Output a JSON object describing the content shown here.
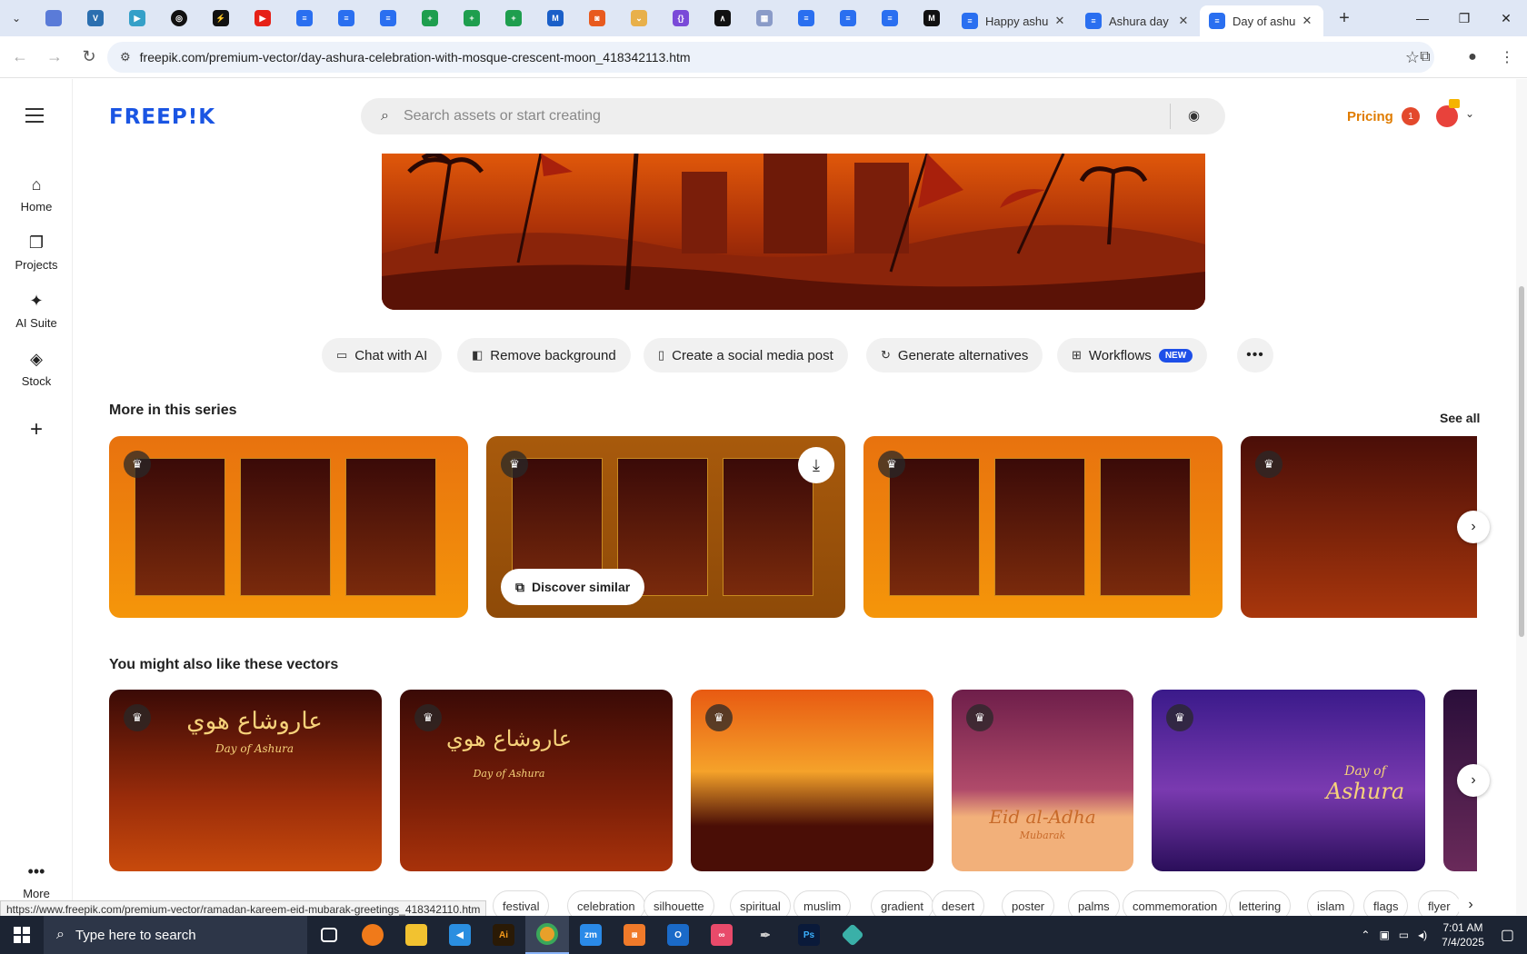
{
  "browser": {
    "tabs": [
      {
        "label": "Happy ashu",
        "icon": "docs-icon"
      },
      {
        "label": "Ashura day",
        "icon": "docs-icon"
      },
      {
        "label": "Day of ashu",
        "icon": "docs-icon",
        "active": true
      }
    ],
    "url": "freepik.com/premium-vector/day-ashura-celebration-with-mosque-crescent-moon_418342113.htm",
    "status_url": "https://www.freepik.com/premium-vector/ramadan-kareem-eid-mubarak-greetings_418342110.htm"
  },
  "sidebar": {
    "items": [
      {
        "label": "Home",
        "icon": "home-icon"
      },
      {
        "label": "Projects",
        "icon": "projects-icon"
      },
      {
        "label": "AI Suite",
        "icon": "sparkle-icon"
      },
      {
        "label": "Stock",
        "icon": "stock-icon"
      }
    ],
    "more_label": "More"
  },
  "header": {
    "logo": "FREEP!K",
    "search_placeholder": "Search assets or start creating",
    "pricing": "Pricing",
    "notification_count": "1"
  },
  "actions": {
    "chat": "Chat with AI",
    "remove_bg": "Remove background",
    "social": "Create a social media post",
    "alternatives": "Generate alternatives",
    "workflows": "Workflows",
    "new_badge": "NEW"
  },
  "series": {
    "title": "More in this series",
    "see_all": "See all",
    "discover": "Discover similar"
  },
  "vectors": {
    "title": "You might also like these vectors",
    "card1": {
      "arabic": "عاروشاع هوي",
      "english": "Day of Ashura"
    },
    "card2": {
      "arabic": "عاروشاع هوي",
      "english": "Day of Ashura"
    },
    "card4": {
      "title": "Eid al-Adha",
      "sub": "Mubarak"
    },
    "card5": {
      "title": "Day of",
      "title2": "Ashura"
    }
  },
  "tags": [
    "festival",
    "celebration",
    "silhouette",
    "spiritual",
    "muslim",
    "gradient",
    "desert",
    "poster",
    "palms",
    "commemoration",
    "lettering",
    "islam",
    "flags",
    "flyer"
  ],
  "taskbar": {
    "search_placeholder": "Type here to search",
    "time": "7:01 AM",
    "date": "7/4/2025"
  },
  "colors": {
    "brand": "#1a55e3",
    "pricing": "#e07c00",
    "new_badge": "#1e4fe8"
  }
}
